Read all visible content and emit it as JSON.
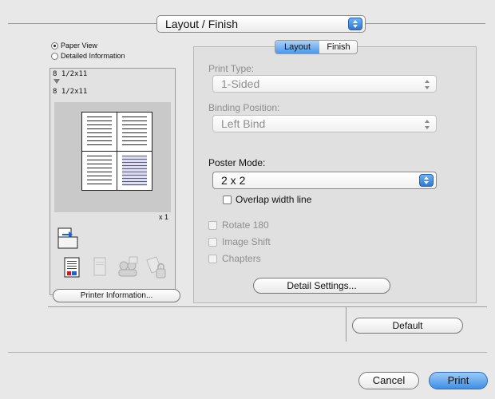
{
  "section_selector": {
    "value": "Layout / Finish"
  },
  "left": {
    "radio_paper_view": "Paper View",
    "radio_detailed_info": "Detailed Information",
    "paper_size_top": "8 1/2x11",
    "paper_size_bottom": "8 1/2x11",
    "copies": "x 1",
    "printer_info_button": "Printer Information..."
  },
  "tabs": [
    {
      "label": "Layout",
      "active": true
    },
    {
      "label": "Finish",
      "active": false
    }
  ],
  "settings": {
    "print_type_label": "Print Type:",
    "print_type_value": "1-Sided",
    "binding_label": "Binding Position:",
    "binding_value": "Left Bind",
    "poster_label": "Poster Mode:",
    "poster_value": "2 x 2",
    "overlap_label": "Overlap width line",
    "rotate_label": "Rotate 180",
    "image_shift_label": "Image Shift",
    "chapters_label": "Chapters",
    "detail_settings_button": "Detail Settings..."
  },
  "buttons": {
    "default": "Default",
    "cancel": "Cancel",
    "print": "Print"
  },
  "colors": {
    "accent_blue": "#3f8ee6",
    "window_bg": "#e8e8e8"
  }
}
